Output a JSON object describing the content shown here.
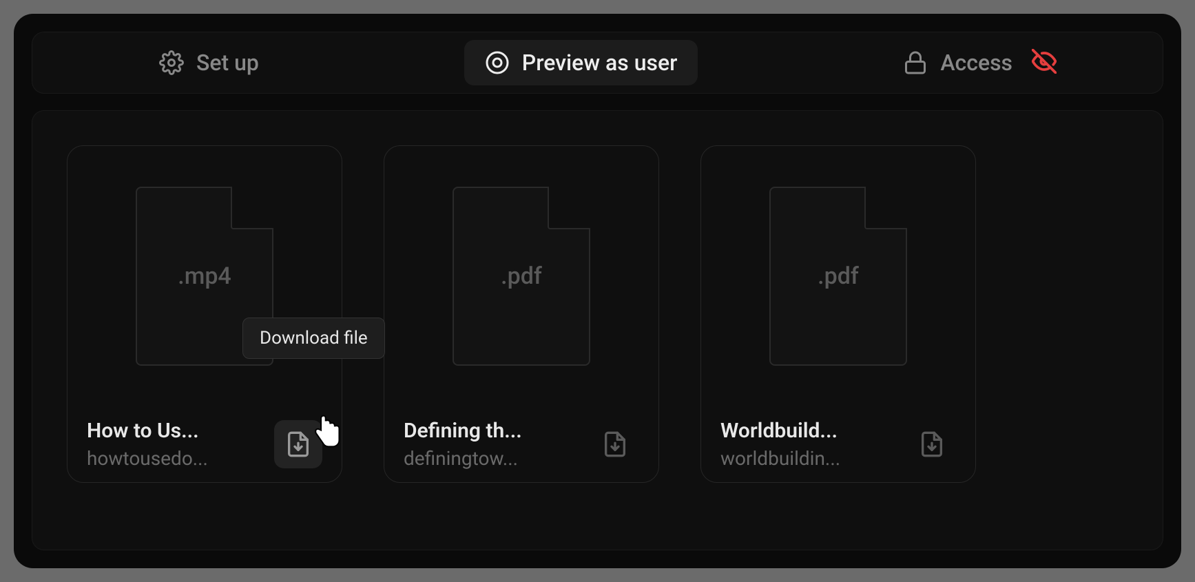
{
  "toolbar": {
    "setup": "Set up",
    "preview": "Preview as user",
    "access": "Access"
  },
  "tooltip": "Download file",
  "files": [
    {
      "ext": ".mp4",
      "title": "How to Us...",
      "subtitle": "howtousedo..."
    },
    {
      "ext": ".pdf",
      "title": "Defining th...",
      "subtitle": "definingtow..."
    },
    {
      "ext": ".pdf",
      "title": "Worldbuild...",
      "subtitle": "worldbuildin..."
    }
  ]
}
